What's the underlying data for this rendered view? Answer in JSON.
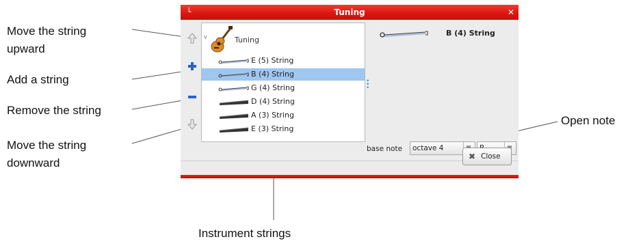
{
  "window": {
    "title": "Tuning",
    "close_label": "Close"
  },
  "tree": {
    "root_label": "Tuning",
    "strings": [
      {
        "label": "E (5) String",
        "wound": false,
        "selected": false
      },
      {
        "label": "B (4) String",
        "wound": false,
        "selected": true
      },
      {
        "label": "G (4) String",
        "wound": false,
        "selected": false
      },
      {
        "label": "D (4) String",
        "wound": true,
        "selected": false
      },
      {
        "label": "A (3) String",
        "wound": true,
        "selected": false
      },
      {
        "label": "E (3) String",
        "wound": true,
        "selected": false
      }
    ]
  },
  "detail": {
    "selected_string": "B (4) String",
    "base_note_label": "base note",
    "octave_value": "octave 4",
    "note_value": "B"
  },
  "annotations": {
    "move_up_line1": "Move the string",
    "move_up_line2": "upward",
    "add": "Add a string",
    "remove": "Remove the string",
    "move_down_line1": "Move the string",
    "move_down_line2": "downward",
    "open_note": "Open note",
    "instrument_strings": "Instrument strings"
  },
  "icons": {
    "move_up": "arrow-up-icon",
    "add": "plus-icon",
    "remove": "minus-icon",
    "move_down": "arrow-down-icon",
    "instrument": "guitar-icon",
    "close": "close-icon"
  },
  "colors": {
    "titlebar": "#d8150f",
    "selection": "#9fc6ef",
    "add_remove": "#2a62c9"
  }
}
